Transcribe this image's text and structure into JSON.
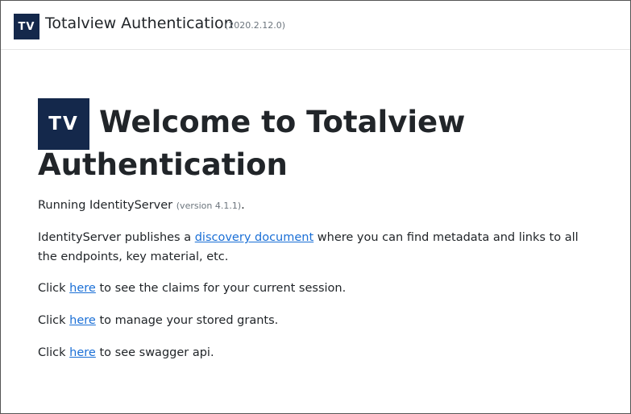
{
  "navbar": {
    "logo_text": "TV",
    "title": "Totalview Authentication",
    "version": "(2020.2.12.0)"
  },
  "main": {
    "logo_text": "TV",
    "heading": "Welcome to Totalview Authentication",
    "running": {
      "prefix": "Running IdentityServer",
      "version": "(version 4.1.1)",
      "suffix": "."
    },
    "discovery": {
      "prefix": "IdentityServer publishes a",
      "link": "discovery document",
      "suffix": "where you can find metadata and links to all the endpoints, key material, etc."
    },
    "claims": {
      "prefix": "Click",
      "link": "here",
      "suffix": "to see the claims for your current session."
    },
    "grants": {
      "prefix": "Click",
      "link": "here",
      "suffix": "to manage your stored grants."
    },
    "swagger": {
      "prefix": "Click",
      "link": "here",
      "suffix": "to see swagger api."
    }
  },
  "colors": {
    "brand": "#14284b",
    "link": "#1a6fd6",
    "muted": "#6c757d",
    "text": "#212529"
  }
}
